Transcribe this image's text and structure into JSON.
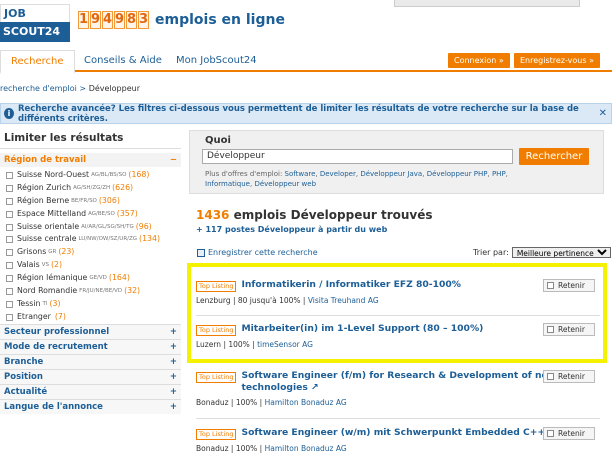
{
  "header": {
    "logo_line1": "JOB",
    "logo_line2": "SCOUT24",
    "counter_digits": [
      "1",
      "9",
      "4",
      "9",
      "8",
      "3"
    ],
    "counter_label": "emplois en ligne"
  },
  "tabs": [
    {
      "label": "Recherche",
      "active": true
    },
    {
      "label": "Conseils & Aide",
      "active": false
    },
    {
      "label": "Mon JobScout24",
      "active": false
    }
  ],
  "auth": {
    "login": "Connexion »",
    "register": "Enregistrez-vous »"
  },
  "breadcrumb": {
    "link": "recherche d'emploi",
    "sep": " > ",
    "current": "Développeur"
  },
  "info_bar": {
    "text": "Recherche avancée? Les filtres ci-dessous vous permettent de limiter les résultats de votre recherche sur la base de différents critères.",
    "close": "✕"
  },
  "sidebar": {
    "title": "Limiter les résultats",
    "region_head": "Région de travail",
    "regions": [
      {
        "label": "Suisse Nord-Ouest",
        "small": "AG/BL/BS/SO",
        "count": "(168)"
      },
      {
        "label": "Région Zurich",
        "small": "AG/SH/ZG/ZH",
        "count": "(626)"
      },
      {
        "label": "Région Berne",
        "small": "BE/FR/SO",
        "count": "(306)"
      },
      {
        "label": "Espace Mittelland",
        "small": "AG/BE/SO",
        "count": "(357)"
      },
      {
        "label": "Suisse orientale",
        "small": "AI/AR/GL/SG/SH/TG",
        "count": "(96)"
      },
      {
        "label": "Suisse centrale",
        "small": "LU/NW/OW/SZ/UR/ZG",
        "count": "(134)"
      },
      {
        "label": "Grisons",
        "small": "GR",
        "count": "(23)"
      },
      {
        "label": "Valais",
        "small": "VS",
        "count": "(2)"
      },
      {
        "label": "Région lémanique",
        "small": "GE/VD",
        "count": "(164)"
      },
      {
        "label": "Nord Romandie",
        "small": "FR/JU/NE/BE/VD",
        "count": "(32)"
      },
      {
        "label": "Tessin",
        "small": "TI",
        "count": "(3)"
      },
      {
        "label": "Etranger",
        "small": "",
        "count": "(7)"
      }
    ],
    "sections": [
      "Secteur professionnel",
      "Mode de recrutement",
      "Branche",
      "Position",
      "Actualité",
      "Langue de l'annonce"
    ]
  },
  "search": {
    "label": "Quoi",
    "value": "Développeur",
    "button": "Rechercher",
    "suggest_prefix": "Plus d'offres d'emploi: ",
    "suggestions": [
      "Software",
      "Developer",
      "Développeur Java",
      "Développeur PHP",
      "PHP",
      "Informatique",
      "Développeur web"
    ]
  },
  "results": {
    "count": "1436",
    "title_rest": "emplois Développeur trouvés",
    "sub": "+ 117 postes Développeur à partir du web",
    "save_search": "Enregistrer cette recherche",
    "sort_label": "Trier par:",
    "sort_value": "Meilleure pertinence"
  },
  "jobs": [
    {
      "badge": "Top Listing",
      "title": "Informatikerin / Informatiker EFZ 80-100%",
      "meta": "Lenzburg | 80 jusqu'à 100% | ",
      "company": "Visita Treuhand AG",
      "save": "Retenir"
    },
    {
      "badge": "Top Listing",
      "title": "Mitarbeiter(in) im 1-Level Support (80 – 100%)",
      "meta": "Luzern | 100% | ",
      "company": "timeSensor AG",
      "save": "Retenir"
    },
    {
      "badge": "Top Listing",
      "title": "Software Engineer (f/m) for Research & Development of new technologies",
      "meta": "Bonaduz | 100% | ",
      "company": "Hamilton Bonaduz AG",
      "save": "Retenir"
    },
    {
      "badge": "Top Listing",
      "title": "Software Engineer (w/m) mit Schwerpunkt Embedded C++",
      "meta": "Bonaduz | 100% | ",
      "company": "Hamilton Bonaduz AG",
      "save": "Retenir"
    }
  ]
}
